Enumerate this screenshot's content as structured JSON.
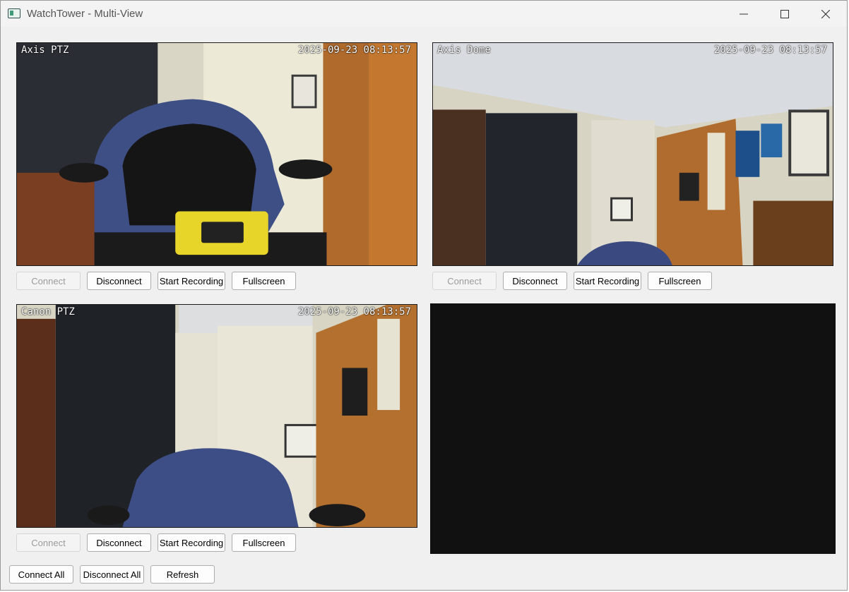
{
  "window": {
    "title": "WatchTower - Multi-View"
  },
  "cameras": [
    {
      "name": "Axis PTZ",
      "timestamp": "2025-09-23 08:13:57",
      "buttons": {
        "connect": "Connect",
        "disconnect": "Disconnect",
        "record": "Start Recording",
        "fullscreen": "Fullscreen"
      }
    },
    {
      "name": "Axis Dome",
      "timestamp": "2025-09-23 08:13:57",
      "buttons": {
        "connect": "Connect",
        "disconnect": "Disconnect",
        "record": "Start Recording",
        "fullscreen": "Fullscreen"
      }
    },
    {
      "name": "Canon PTZ",
      "timestamp": "2025-09-23 08:13:57",
      "buttons": {
        "connect": "Connect",
        "disconnect": "Disconnect",
        "record": "Start Recording",
        "fullscreen": "Fullscreen"
      }
    }
  ],
  "footer": {
    "connect_all": "Connect All",
    "disconnect_all": "Disconnect All",
    "refresh": "Refresh"
  },
  "colors": {
    "window_bg": "#f0f0f0",
    "empty_slot": "#111111",
    "disabled_text": "#9b9b9b"
  }
}
